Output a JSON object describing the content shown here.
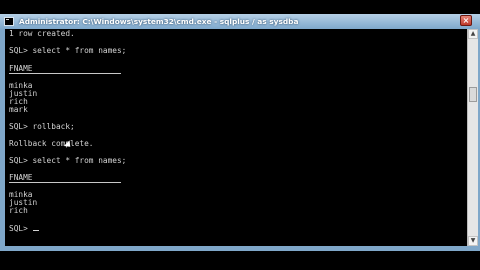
{
  "window": {
    "title": "Administrator: C:\\Windows\\system32\\cmd.exe - sqlplus  / as sysdba",
    "icon": "console-icon",
    "close_label": "×"
  },
  "console": {
    "lines": [
      "1 row created.",
      "SQL> select * from names;",
      "FNAME",
      "minka",
      "justin",
      "rich",
      "mark",
      "SQL> rollback;",
      "Rollback complete.",
      "SQL> select * from names;",
      "FNAME",
      "minka",
      "justin",
      "rich",
      "SQL> "
    ]
  },
  "colors": {
    "titlebar": "#7fa7c9",
    "console_bg": "#000000",
    "console_text": "#d4d4d4",
    "close_button": "#c0392b"
  }
}
